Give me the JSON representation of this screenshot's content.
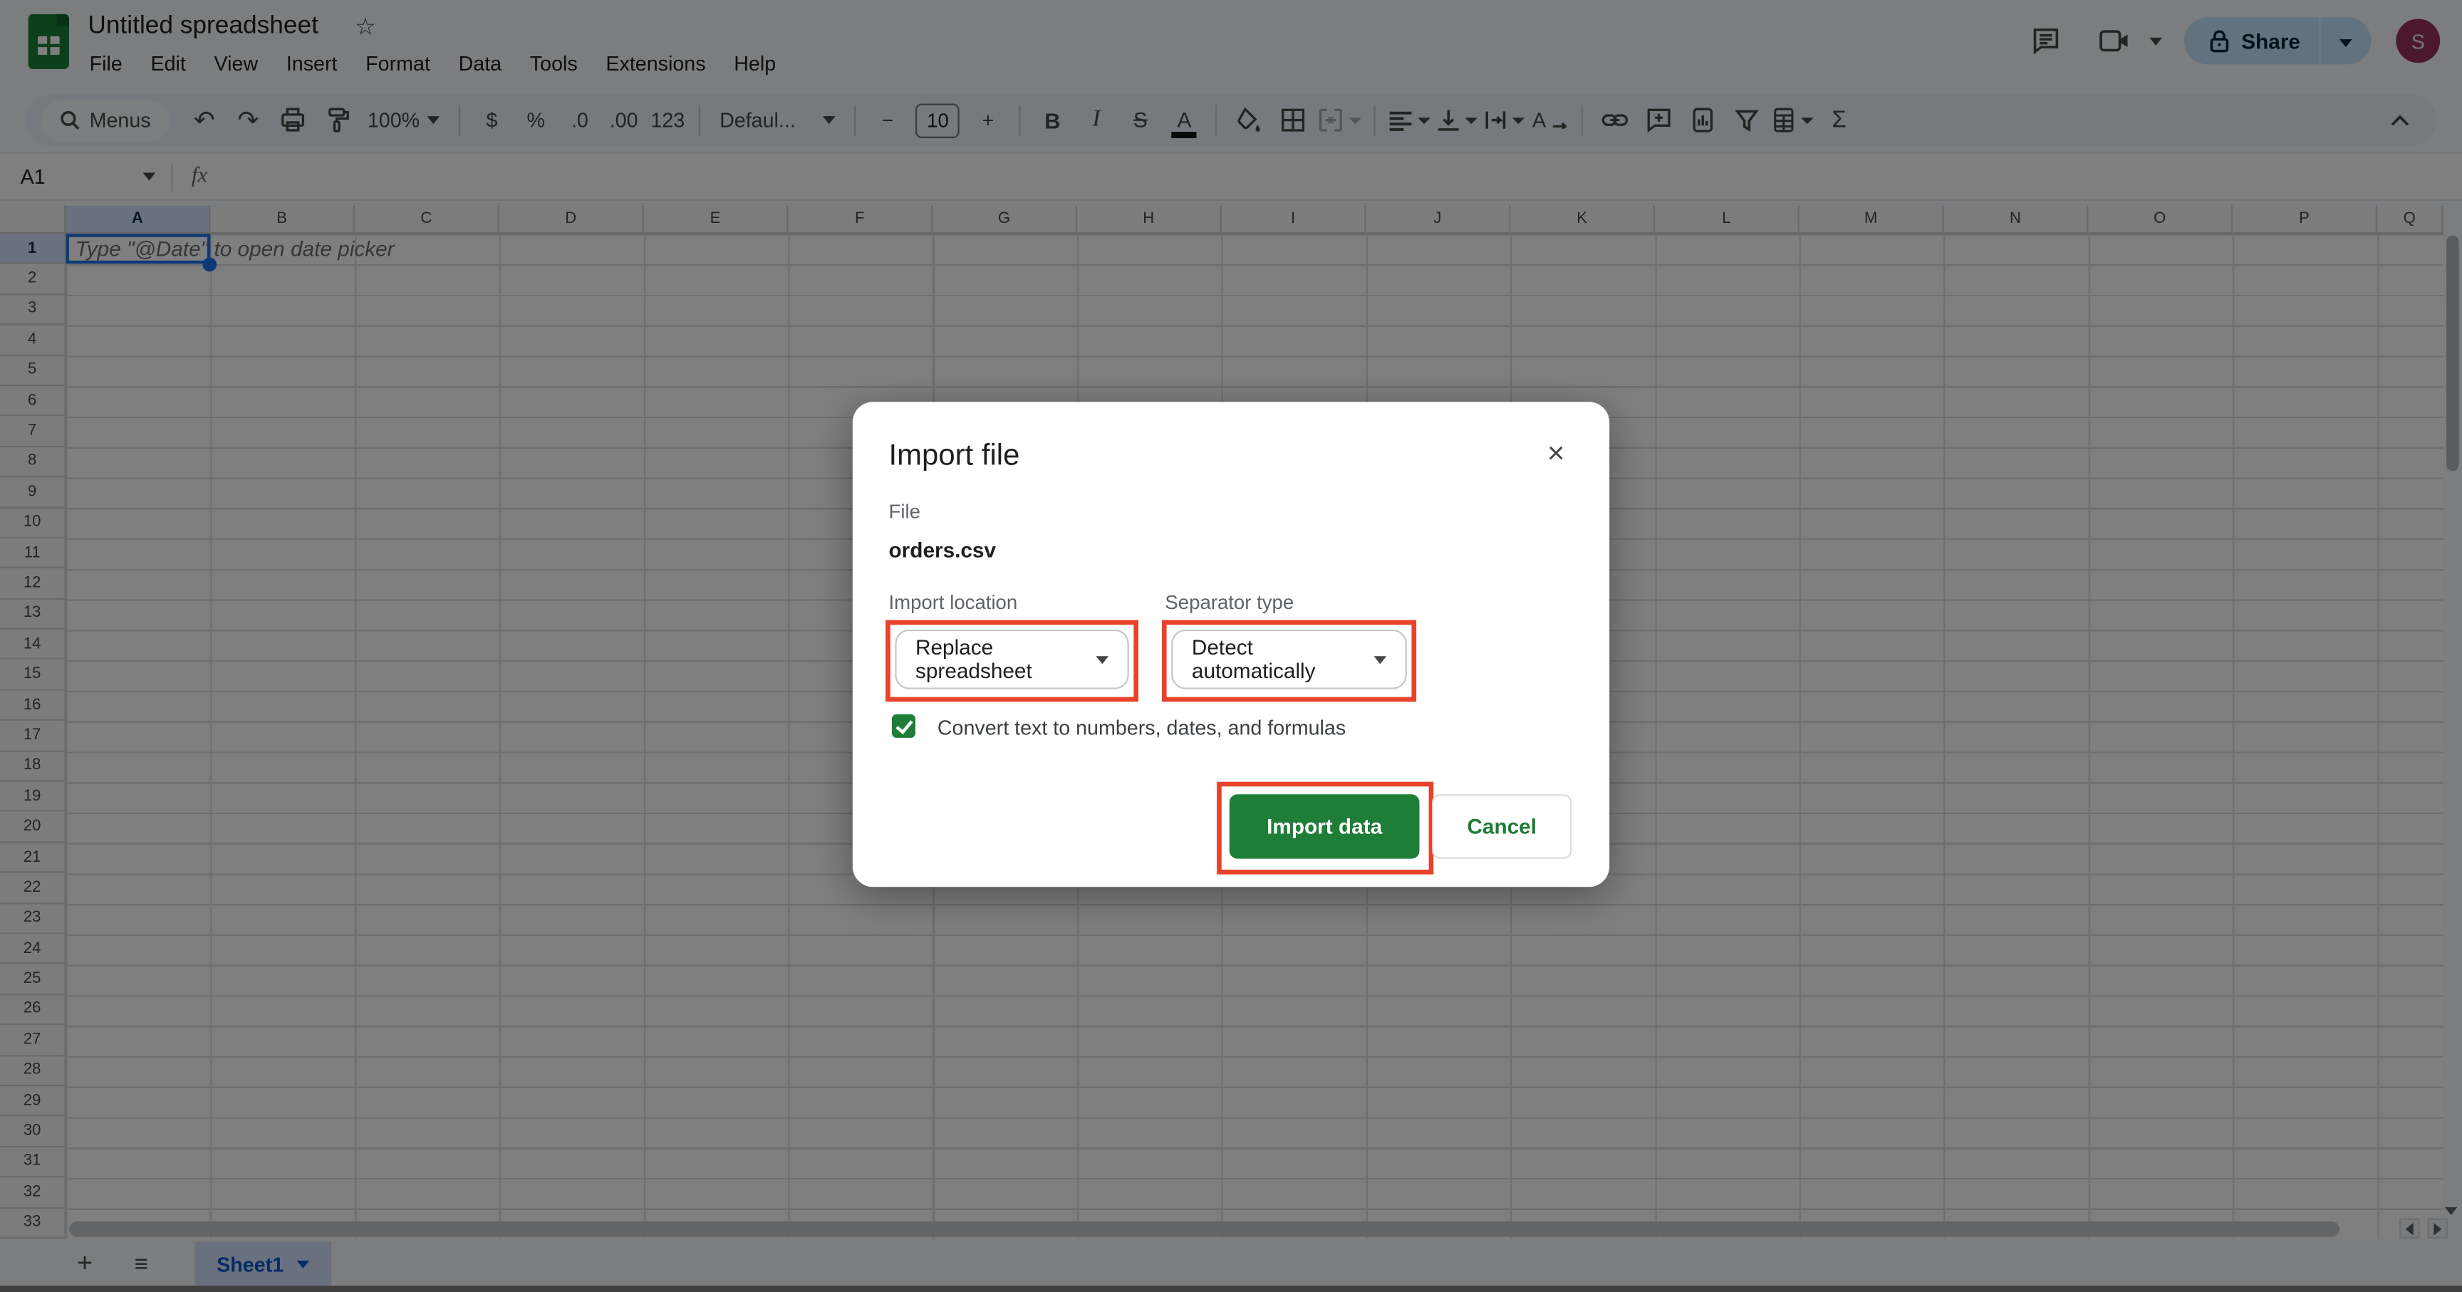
{
  "header": {
    "title": "Untitled spreadsheet",
    "star": "☆",
    "menus": [
      "File",
      "Edit",
      "View",
      "Insert",
      "Format",
      "Data",
      "Tools",
      "Extensions",
      "Help"
    ],
    "share": "Share",
    "avatar": "S"
  },
  "toolbar": {
    "menus": "Menus",
    "undo": "↶",
    "redo": "↷",
    "zoom": "100%",
    "currency": "$",
    "percent": "%",
    "decimal_decrease": ".0",
    "decimal_increase": ".00",
    "format_123": "123",
    "font": "Defaul...",
    "minus": "−",
    "font_size": "10",
    "plus": "+",
    "bold": "B",
    "italic": "I",
    "strikethrough": "S",
    "text_color": "A",
    "functions": "Σ"
  },
  "formula_bar": {
    "cell_ref": "A1",
    "fx": "fx"
  },
  "grid": {
    "columns": [
      "A",
      "B",
      "C",
      "D",
      "E",
      "F",
      "G",
      "H",
      "I",
      "J",
      "K",
      "L",
      "M",
      "N",
      "O",
      "P",
      "Q"
    ],
    "row_count": 33,
    "selected_column": "A",
    "selected_row": 1,
    "a1_placeholder": "Type \"@Date\" to open date picker"
  },
  "sheet_bar": {
    "add": "+",
    "all_sheets": "≡",
    "tab": "Sheet1"
  },
  "dialog": {
    "title": "Import file",
    "close": "×",
    "file_label": "File",
    "file_name": "orders.csv",
    "import_location_label": "Import location",
    "import_location_value": "Replace spreadsheet",
    "separator_label": "Separator type",
    "separator_value": "Detect automatically",
    "checkbox_label": "Convert text to numbers, dates, and formulas",
    "checkbox_checked": true,
    "import_button": "Import data",
    "cancel_button": "Cancel"
  },
  "colors": {
    "annotation_red": "#e8432a",
    "primary_green": "#1e7d37",
    "selection_blue": "#1a73e8",
    "header_highlight": "#d3e3fd",
    "share_pill": "#c2e7ff",
    "avatar_bg": "#96305a",
    "tab_text": "#0b57d0",
    "scrim": "rgba(0,0,0,0.5)"
  }
}
